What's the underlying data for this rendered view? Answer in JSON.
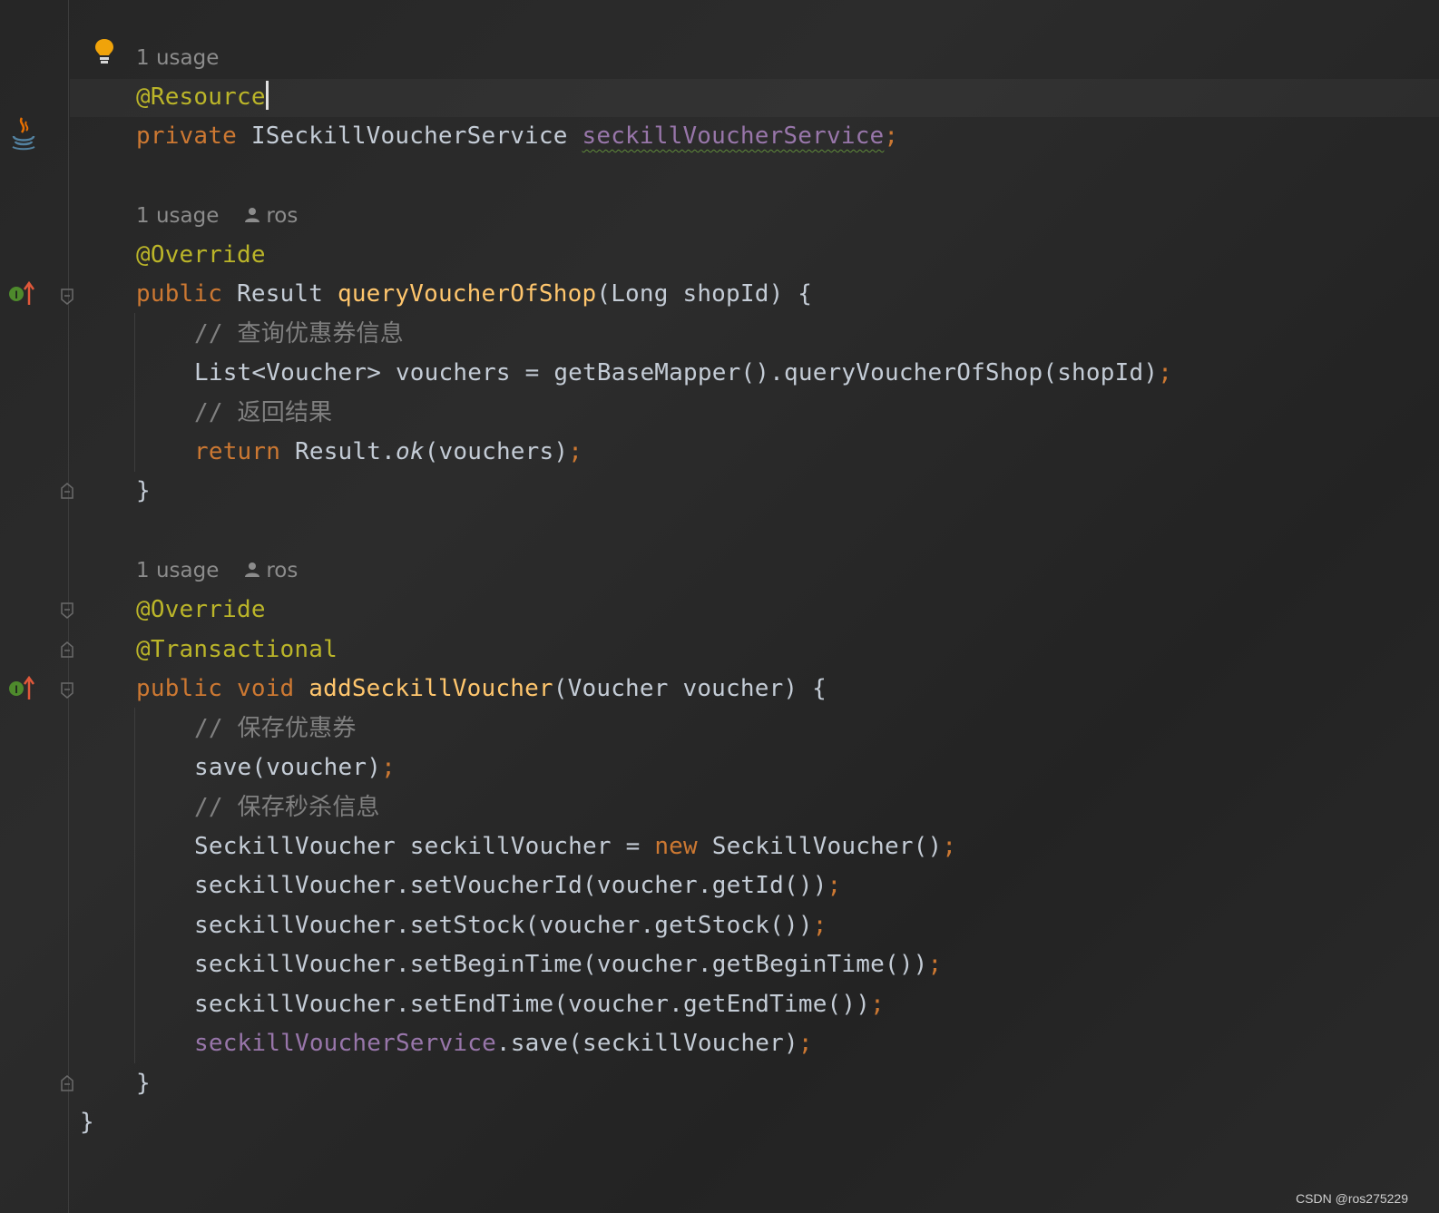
{
  "hints": {
    "resource_usage": "1 usage",
    "query_usage": "1 usage",
    "query_author": "ros",
    "add_usage": "1 usage",
    "add_author": "ros"
  },
  "code": {
    "ann_resource": "@Resource",
    "kw_private": "private",
    "type_service": "ISeckillVoucherService",
    "field_service": "seckillVoucherService",
    "semi": ";",
    "ann_override": "@Override",
    "kw_public": "public",
    "type_result": "Result",
    "method_query": "queryVoucherOfShop",
    "param_query": "(Long shopId) {",
    "comment_query_info": "// 查询优惠券信息",
    "stmt_list": "List<Voucher> vouchers = getBaseMapper().queryVoucherOfShop(shopId)",
    "comment_return": "// 返回结果",
    "kw_return": "return",
    "stmt_result_prefix": "Result.",
    "stmt_result_ok": "ok",
    "stmt_result_args": "(vouchers)",
    "close_brace": "}",
    "ann_override_2": "@Override",
    "ann_transactional": "@Transactional",
    "kw_public_2": "public",
    "kw_void": "void",
    "method_add": "addSeckillVoucher",
    "param_add": "(Voucher voucher) {",
    "comment_save": "// 保存优惠券",
    "stmt_save": "save(voucher)",
    "comment_save_seckill": "// 保存秒杀信息",
    "stmt_new_left": "SeckillVoucher seckillVoucher = ",
    "kw_new": "new",
    "stmt_new_right": " SeckillVoucher()",
    "stmt_set_id": "seckillVoucher.setVoucherId(voucher.getId())",
    "stmt_set_stock": "seckillVoucher.setStock(voucher.getStock())",
    "stmt_set_begin": "seckillVoucher.setBeginTime(voucher.getBeginTime())",
    "stmt_set_end": "seckillVoucher.setEndTime(voucher.getEndTime())",
    "field_service_2": "seckillVoucherService",
    "stmt_service_save": ".save(seckillVoucher)",
    "close_brace_2": "}",
    "close_brace_class": "}"
  },
  "icons": {
    "bulb": "lightbulb-icon",
    "java": "java-bean-icon",
    "implements": "implements-method-icon",
    "fold": "fold-marker-icon",
    "person": "person-icon"
  },
  "colors": {
    "background": "#2b2b2b",
    "keyword": "#cc7832",
    "annotation": "#bbb529",
    "method": "#ffc66d",
    "field": "#9876aa",
    "comment": "#808080",
    "text": "#c4ccd6"
  },
  "watermark": "CSDN @ros275229"
}
